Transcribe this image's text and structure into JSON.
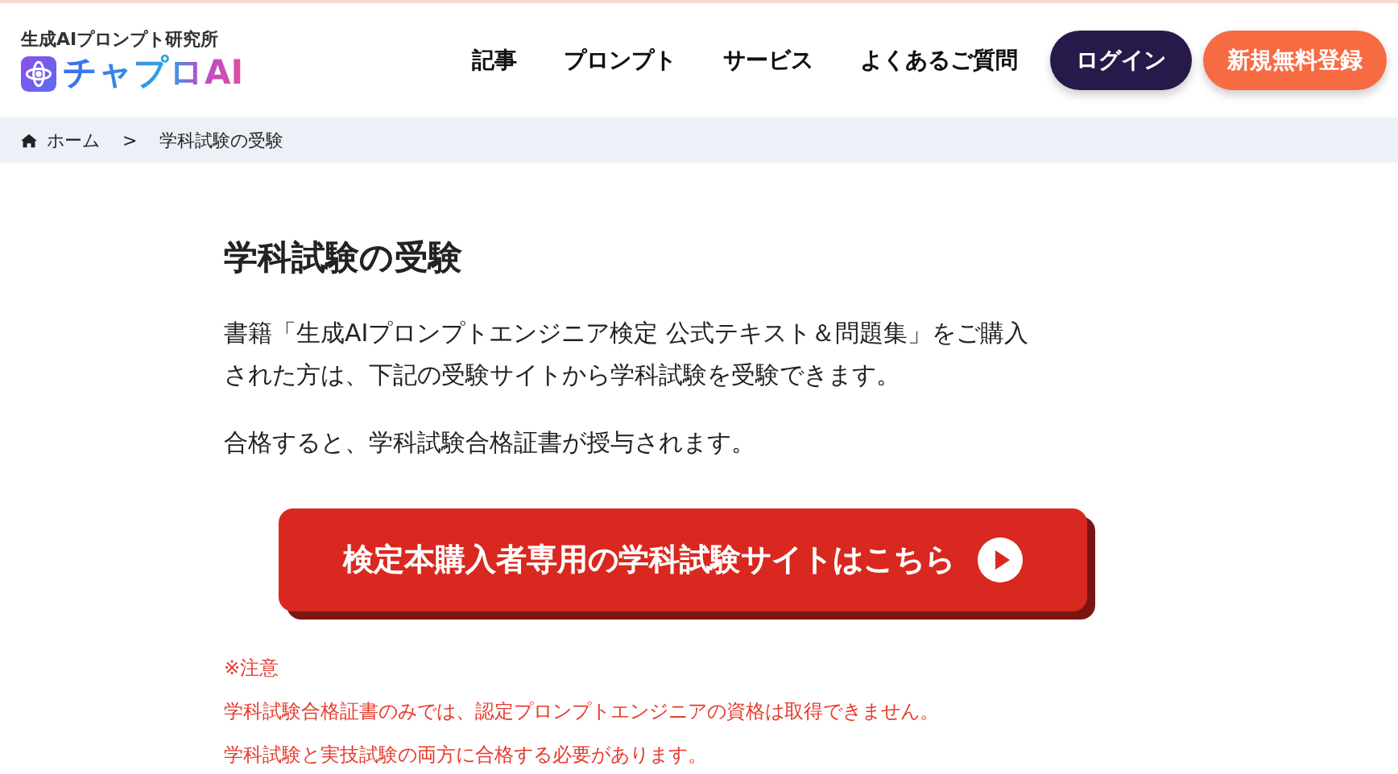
{
  "header": {
    "tagline": "生成AIプロンプト研究所",
    "logo_text": "チャプロAI",
    "nav": [
      {
        "label": "記事"
      },
      {
        "label": "プロンプト"
      },
      {
        "label": "サービス"
      },
      {
        "label": "よくあるご質問"
      }
    ],
    "login_button": "ログイン",
    "signup_button": "新規無料登録"
  },
  "breadcrumb": [
    {
      "label": "ホーム",
      "kind": "home"
    },
    {
      "label": "学科試験の受験",
      "kind": "current"
    }
  ],
  "breadcrumb_separator": ">",
  "main": {
    "title": "学科試験の受験",
    "paragraphs": [
      "書籍「生成AIプロンプトエンジニア検定 公式テキスト＆問題集」をご購入された方は、下記の受験サイトから学科試験を受験できます。",
      "合格すると、学科試験合格証書が授与されます。"
    ],
    "cta_button": "検定本購入者専用の学科試験サイトはこちら",
    "note_heading": "※注意",
    "notes": [
      "学科試験合格証書のみでは、認定プロンプトエンジニアの資格は取得できません。",
      "学科試験と実技試験の両方に合格する必要があります。"
    ]
  }
}
